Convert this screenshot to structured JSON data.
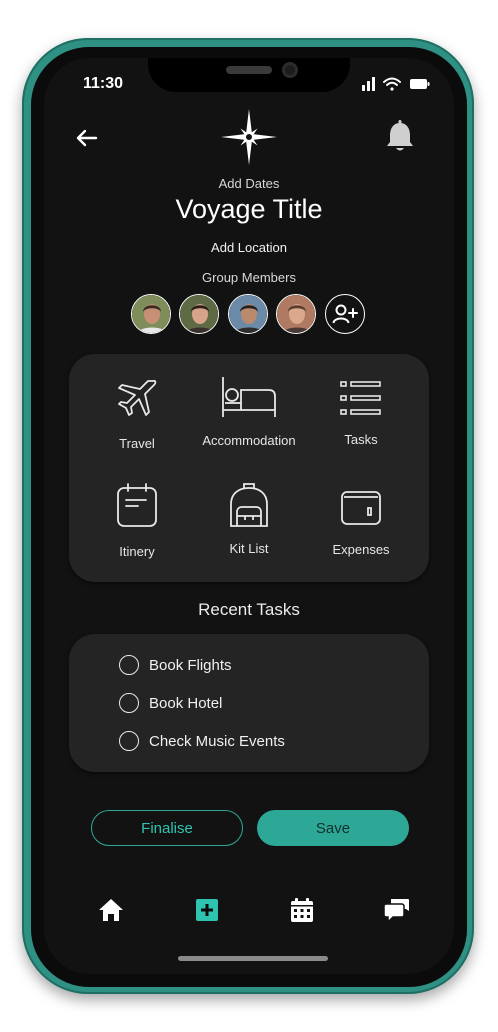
{
  "status": {
    "time": "11:30"
  },
  "header": {
    "add_dates": "Add Dates",
    "title": "Voyage Title",
    "add_location": "Add Location",
    "group_members_label": "Group Members"
  },
  "members": [
    {
      "name": "member-1",
      "skin": "#c79074",
      "hair": "#3a2a22",
      "shirt": "#e8e8e8",
      "bg": "#7e8d5a"
    },
    {
      "name": "member-2",
      "skin": "#d8a489",
      "hair": "#2a1d18",
      "shirt": "#3b2f2d",
      "bg": "#5d6a43"
    },
    {
      "name": "member-3",
      "skin": "#b98a6e",
      "hair": "#222",
      "shirt": "#2c2c2c",
      "bg": "#6a8aa8"
    },
    {
      "name": "member-4",
      "skin": "#d9a88d",
      "hair": "#5a3a2a",
      "shirt": "#4a3a36",
      "bg": "#b07a62"
    }
  ],
  "categories": [
    {
      "id": "travel",
      "label": "Travel",
      "icon": "plane-icon"
    },
    {
      "id": "accommodation",
      "label": "Accommodation",
      "icon": "bed-icon"
    },
    {
      "id": "tasks",
      "label": "Tasks",
      "icon": "list-icon"
    },
    {
      "id": "itinery",
      "label": "Itinery",
      "icon": "calendar-icon"
    },
    {
      "id": "kit-list",
      "label": "Kit List",
      "icon": "backpack-icon"
    },
    {
      "id": "expenses",
      "label": "Expenses",
      "icon": "wallet-icon"
    }
  ],
  "recent_tasks": {
    "title": "Recent Tasks",
    "items": [
      "Book Flights",
      "Book Hotel",
      "Check Music Events"
    ]
  },
  "actions": {
    "finalise": "Finalise",
    "save": "Save"
  },
  "nav": [
    {
      "id": "home",
      "icon": "home-icon"
    },
    {
      "id": "add",
      "icon": "add-icon"
    },
    {
      "id": "calendar",
      "icon": "calendar-icon"
    },
    {
      "id": "chat",
      "icon": "chat-icon"
    }
  ],
  "colors": {
    "accent": "#2ea896",
    "background": "#121212",
    "card": "#242424",
    "frame": "#2e9184"
  }
}
